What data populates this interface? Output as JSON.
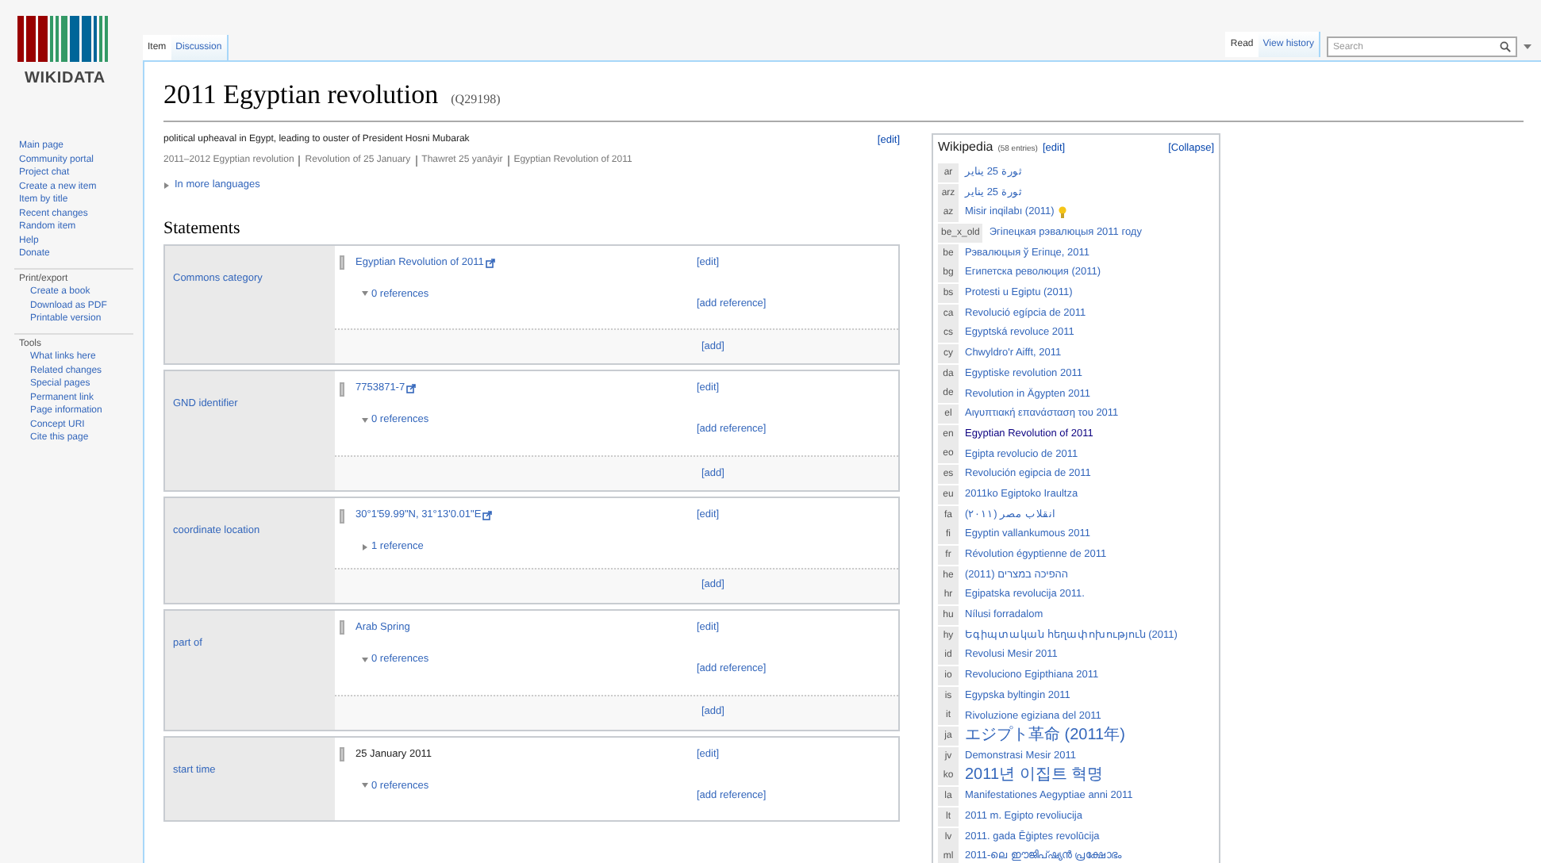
{
  "logo": {
    "wordmark": "WIKIDATA"
  },
  "sidebar": {
    "navigation": [
      "Main page",
      "Community portal",
      "Project chat",
      "Create a new item",
      "Item by title",
      "Recent changes",
      "Random item",
      "Help",
      "Donate"
    ],
    "sections": [
      {
        "heading": "Print/export",
        "items": [
          "Create a book",
          "Download as PDF",
          "Printable version"
        ]
      },
      {
        "heading": "Tools",
        "items": [
          "What links here",
          "Related changes",
          "Special pages",
          "Permanent link",
          "Page information",
          "Concept URI",
          "Cite this page"
        ]
      }
    ]
  },
  "page_tabs": [
    {
      "label": "Item",
      "selected": true
    },
    {
      "label": "Discussion",
      "selected": false
    }
  ],
  "view_tabs": [
    {
      "label": "Read",
      "selected": true
    },
    {
      "label": "View history",
      "selected": false
    }
  ],
  "search": {
    "placeholder": "Search"
  },
  "title": "2011 Egyptian revolution",
  "item_id": "(Q29198)",
  "description": "political upheaval in Egypt, leading to ouster of President Hosni Mubarak",
  "description_edit": "[edit]",
  "aliases": [
    "2011–2012 Egyptian revolution",
    "Revolution of 25 January",
    "Thawret 25 yanāyir",
    "Egyptian Revolution of 2011"
  ],
  "more_languages": {
    "label": "In more languages",
    "expanded": false
  },
  "statements_heading": "Statements",
  "statements": [
    {
      "property": "Commons category",
      "value": "Egyptian Revolution of 2011",
      "kind": "external",
      "edit": "[edit]",
      "references": "0 references",
      "expanded": true,
      "add_reference": "[add reference]",
      "add": "[add]"
    },
    {
      "property": "GND identifier",
      "value": "7753871-7",
      "kind": "external",
      "edit": "[edit]",
      "references": "0 references",
      "expanded": true,
      "add_reference": "[add reference]",
      "add": "[add]"
    },
    {
      "property": "coordinate location",
      "value": "30°1'59.99\"N, 31°13'0.01\"E",
      "kind": "external",
      "edit": "[edit]",
      "references": "1 reference",
      "expanded": false,
      "add": "[add]"
    },
    {
      "property": "part of",
      "value": "Arab Spring",
      "kind": "item",
      "edit": "[edit]",
      "references": "0 references",
      "expanded": true,
      "add_reference": "[add reference]",
      "add": "[add]"
    },
    {
      "property": "start time",
      "value": "25 January 2011",
      "kind": "plain",
      "edit": "[edit]",
      "references": "0 references",
      "expanded": true,
      "add_reference": "[add reference]"
    }
  ],
  "wikipedia": {
    "title": "Wikipedia",
    "count": "(58 entries)",
    "edit": "[edit]",
    "collapse": "[Collapse]",
    "entries": [
      {
        "code": "ar",
        "title": "ثورة 25 يناير",
        "visited": false,
        "good": false
      },
      {
        "code": "arz",
        "title": "ثورة 25 يناير",
        "visited": false,
        "good": false
      },
      {
        "code": "az",
        "title": "Misir inqilabı (2011)",
        "visited": false,
        "good": true
      },
      {
        "code": "be_x_old",
        "title": "Эгіпецкая рэвалюцыя 2011 году",
        "visited": false,
        "good": false
      },
      {
        "code": "be",
        "title": "Рэвалюцыя ў Егіпце, 2011",
        "visited": false,
        "good": false
      },
      {
        "code": "bg",
        "title": "Египетска революция (2011)",
        "visited": false,
        "good": false
      },
      {
        "code": "bs",
        "title": "Protesti u Egiptu (2011)",
        "visited": false,
        "good": false
      },
      {
        "code": "ca",
        "title": "Revolució egípcia de 2011",
        "visited": false,
        "good": false
      },
      {
        "code": "cs",
        "title": "Egyptská revoluce 2011",
        "visited": false,
        "good": false
      },
      {
        "code": "cy",
        "title": "Chwyldro'r Aifft, 2011",
        "visited": false,
        "good": false
      },
      {
        "code": "da",
        "title": "Egyptiske revolution 2011",
        "visited": false,
        "good": false
      },
      {
        "code": "de",
        "title": "Revolution in Ägypten 2011",
        "visited": false,
        "good": false
      },
      {
        "code": "el",
        "title": "Αιγυπτιακή επανάσταση του 2011",
        "visited": false,
        "good": false
      },
      {
        "code": "en",
        "title": "Egyptian Revolution of 2011",
        "visited": true,
        "good": false
      },
      {
        "code": "eo",
        "title": "Egipta revolucio de 2011",
        "visited": false,
        "good": false
      },
      {
        "code": "es",
        "title": "Revolución egipcia de 2011",
        "visited": false,
        "good": false
      },
      {
        "code": "eu",
        "title": "2011ko Egiptoko Iraultza",
        "visited": false,
        "good": false
      },
      {
        "code": "fa",
        "title": "انقلاب مصر (۲۰۱۱)",
        "visited": false,
        "good": false
      },
      {
        "code": "fi",
        "title": "Egyptin vallankumous 2011",
        "visited": false,
        "good": false
      },
      {
        "code": "fr",
        "title": "Révolution égyptienne de 2011",
        "visited": false,
        "good": false
      },
      {
        "code": "he",
        "title": "ההפיכה במצרים (2011)",
        "visited": false,
        "good": false
      },
      {
        "code": "hr",
        "title": "Egipatska revolucija 2011.",
        "visited": false,
        "good": false
      },
      {
        "code": "hu",
        "title": "Nílusi forradalom",
        "visited": false,
        "good": false
      },
      {
        "code": "hy",
        "title": "Եգիպտական հեղափոխություն (2011)",
        "visited": false,
        "good": false
      },
      {
        "code": "id",
        "title": "Revolusi Mesir 2011",
        "visited": false,
        "good": false
      },
      {
        "code": "io",
        "title": "Revoluciono Egipthiana 2011",
        "visited": false,
        "good": false
      },
      {
        "code": "is",
        "title": "Egypska byltingin 2011",
        "visited": false,
        "good": false
      },
      {
        "code": "it",
        "title": "Rivoluzione egiziana del 2011",
        "visited": false,
        "good": false
      },
      {
        "code": "ja",
        "title": "エジプト革命 (2011年)",
        "visited": false,
        "good": false
      },
      {
        "code": "jv",
        "title": "Demonstrasi Mesir 2011",
        "visited": false,
        "good": false
      },
      {
        "code": "ko",
        "title": "2011년 이집트 혁명",
        "visited": false,
        "good": false
      },
      {
        "code": "la",
        "title": "Manifestationes Aegyptiae anni 2011",
        "visited": false,
        "good": false
      },
      {
        "code": "lt",
        "title": "2011 m. Egipto revoliucija",
        "visited": false,
        "good": false
      },
      {
        "code": "lv",
        "title": "2011. gada Ēģiptes revolūcija",
        "visited": false,
        "good": false
      },
      {
        "code": "ml",
        "title": "2011-ലെ ഈജിപ്ഷ്യൻ പ്രക്ഷോഭം",
        "visited": false,
        "good": false
      }
    ]
  }
}
